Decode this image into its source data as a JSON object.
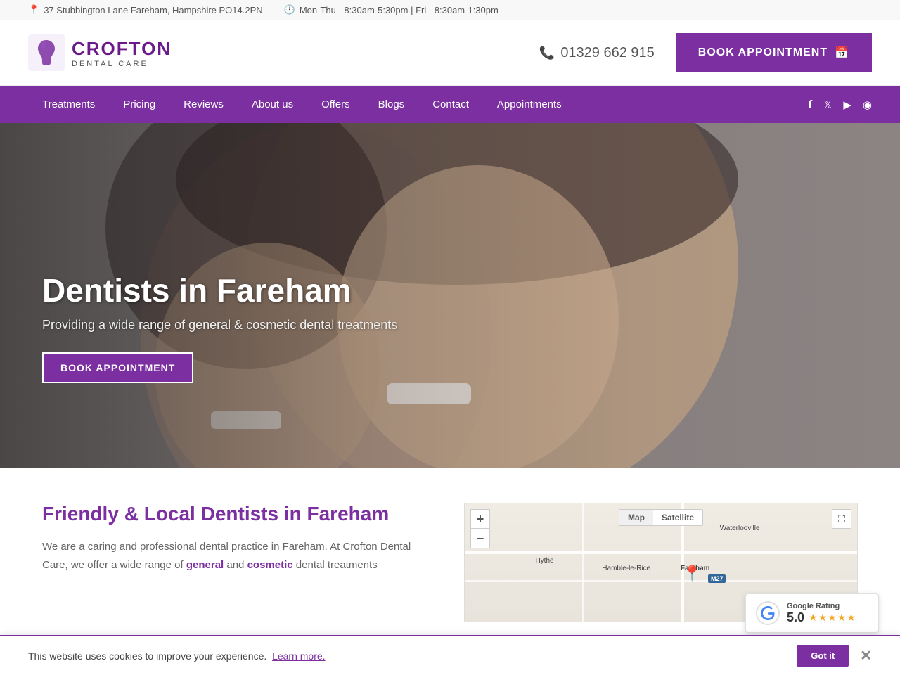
{
  "topbar": {
    "address": "37 Stubbington Lane Fareham, Hampshire PO14.2PN",
    "hours": "Mon-Thu - 8:30am-5:30pm | Fri - 8:30am-1:30pm",
    "address_icon": "📍",
    "clock_icon": "🕐"
  },
  "header": {
    "logo_brand": "CROFTON",
    "logo_sub": "DENTAL CARE",
    "phone": "01329 662 915",
    "book_btn_label": "BOOK APPOINTMENT",
    "calendar_icon": "📅",
    "phone_icon": "📞"
  },
  "nav": {
    "links": [
      {
        "label": "Treatments",
        "href": "#"
      },
      {
        "label": "Pricing",
        "href": "#"
      },
      {
        "label": "Reviews",
        "href": "#"
      },
      {
        "label": "About us",
        "href": "#"
      },
      {
        "label": "Offers",
        "href": "#"
      },
      {
        "label": "Blogs",
        "href": "#"
      },
      {
        "label": "Contact",
        "href": "#"
      },
      {
        "label": "Appointments",
        "href": "#"
      }
    ],
    "social": {
      "facebook_icon": "f",
      "twitter_icon": "t",
      "youtube_icon": "▶",
      "instagram_icon": "◉"
    }
  },
  "hero": {
    "title": "Dentists in Fareham",
    "subtitle": "Providing a wide range of general & cosmetic dental treatments",
    "book_btn_label": "BOOK APPOINTMENT"
  },
  "below_hero": {
    "heading": "Friendly & Local Dentists in Fareham",
    "text_part1": "We are a caring and professional dental practice in Fareham. At Crofton Dental Care, we offer a wide range of ",
    "text_highlight1": "general",
    "text_and": " and ",
    "text_highlight2": "cosmetic",
    "text_part2": " dental treatments",
    "map": {
      "map_btn_label": "Map",
      "satellite_btn_label": "Satellite",
      "zoom_in": "+",
      "zoom_out": "−",
      "expand": "⛶"
    }
  },
  "google_rating": {
    "label": "Google Rating",
    "score": "5.0",
    "stars": "★★★★★",
    "icon": "G"
  },
  "cookie_banner": {
    "text": "This website uses cookies to improve your experience.",
    "link_text": "Learn more.",
    "accept_label": "Got it",
    "close_icon": "✕"
  }
}
